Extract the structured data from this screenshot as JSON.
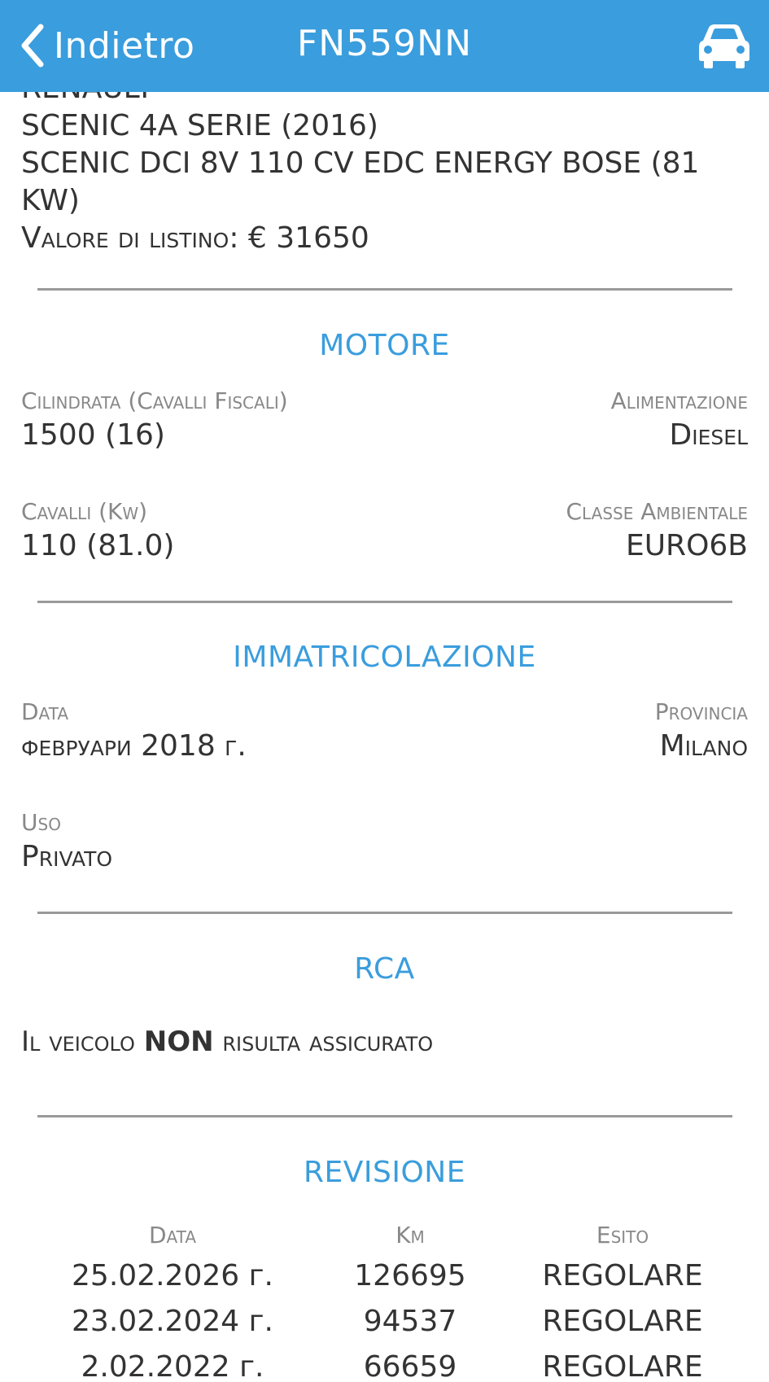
{
  "header": {
    "back_label": "Indietro",
    "title": "FN559NN",
    "background_color": "#3a9ddd",
    "back_icon": "chevron-left-icon",
    "action_icon": "car-icon"
  },
  "vehicle": {
    "make_partial": "RENAULT",
    "model": "SCENIC 4A SERIE (2016)",
    "version_line1": "SCENIC DCI 8V 110 CV EDC ENERGY BOSE (81",
    "version_line2": "KW)",
    "list_price_label": "Valore di listino:",
    "list_price_value": "€ 31650"
  },
  "motore": {
    "title": "MOTORE",
    "cilindrata_label": "Cilindrata (Cavalli Fiscali)",
    "cilindrata_value": "1500 (16)",
    "alimentazione_label": "Alimentazione",
    "alimentazione_value": "Diesel",
    "cavalli_label": "Cavalli (Kw)",
    "cavalli_value": "110 (81.0)",
    "classe_label": "Classe Ambientale",
    "classe_value": "EURO6B"
  },
  "immatricolazione": {
    "title": "IMMATRICOLAZIONE",
    "data_label": "Data",
    "data_value": "февруари 2018 г.",
    "provincia_label": "Provincia",
    "provincia_value": "Milano",
    "uso_label": "Uso",
    "uso_value": "Privato"
  },
  "rca": {
    "title": "RCA",
    "status_prefix": "Il veicolo",
    "status_emphasis": "NON",
    "status_suffix": "risulta assicurato"
  },
  "revisione": {
    "title": "REVISIONE",
    "headers": [
      "Data",
      "Km",
      "Esito"
    ],
    "rows": [
      [
        "25.02.2026 г.",
        "126695",
        "REGOLARE"
      ],
      [
        "23.02.2024 г.",
        "94537",
        "REGOLARE"
      ],
      [
        "2.02.2022 г.",
        "66659",
        "REGOLARE"
      ]
    ]
  }
}
